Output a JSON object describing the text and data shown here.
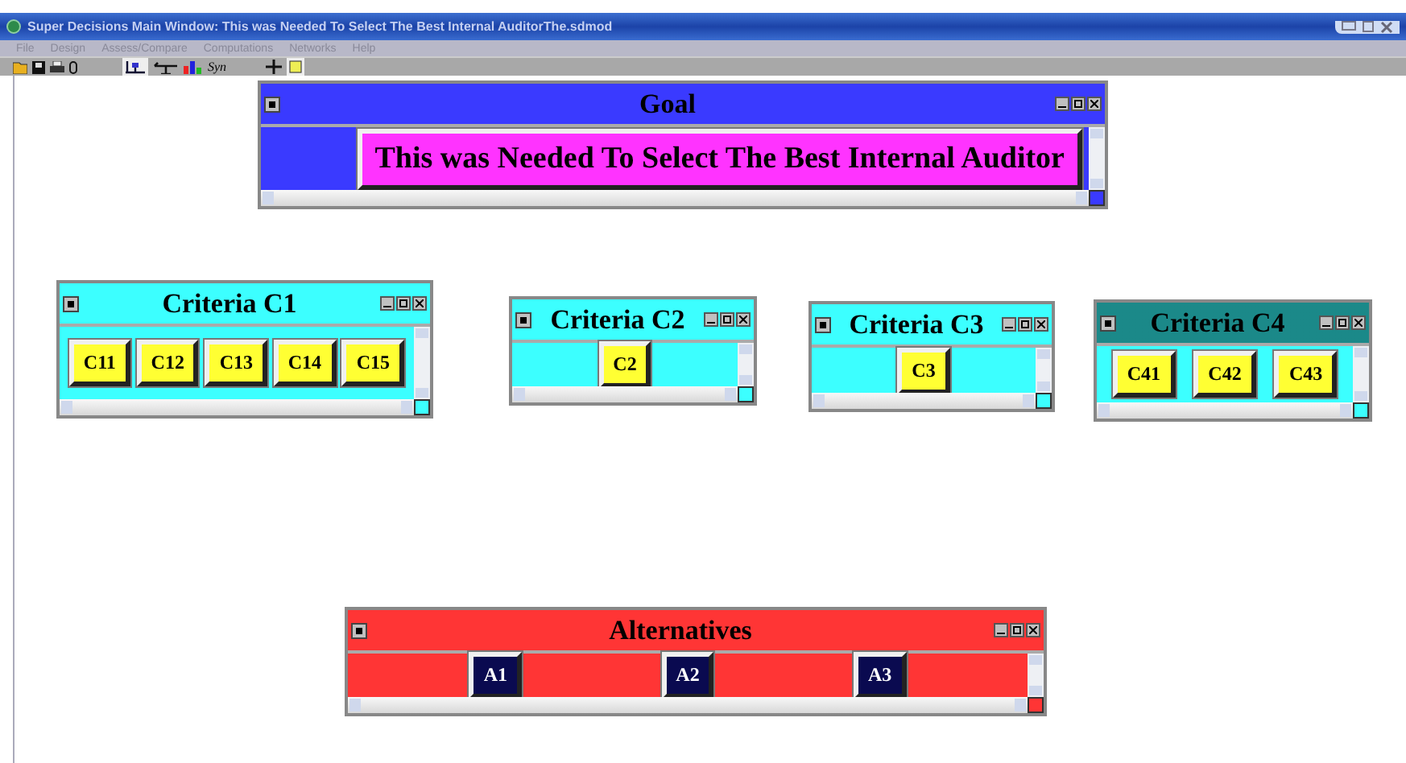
{
  "window": {
    "title": "Super Decisions Main Window: This was Needed To Select The Best Internal AuditorThe.sdmod"
  },
  "menu": [
    "File",
    "Design",
    "Assess/Compare",
    "Computations",
    "Networks",
    "Help"
  ],
  "toolbar": {
    "syn_label": "Syn"
  },
  "clusters": [
    {
      "title": "Goal",
      "kind": "goal",
      "color": "#3a3aff",
      "selected": false,
      "nodes": [
        {
          "label": "This was Needed To Select The Best Internal Auditor"
        }
      ]
    },
    {
      "title": "Criteria C1",
      "kind": "criterion",
      "color": "#3cffff",
      "selected": false,
      "nodes": [
        {
          "label": "C11"
        },
        {
          "label": "C12"
        },
        {
          "label": "C13"
        },
        {
          "label": "C14"
        },
        {
          "label": "C15"
        }
      ]
    },
    {
      "title": "Criteria C2",
      "kind": "criterion",
      "color": "#3cffff",
      "selected": false,
      "nodes": [
        {
          "label": "C2"
        }
      ]
    },
    {
      "title": "Criteria C3",
      "kind": "criterion",
      "color": "#3cffff",
      "selected": false,
      "nodes": [
        {
          "label": "C3"
        }
      ]
    },
    {
      "title": "Criteria C4",
      "kind": "criterion",
      "color": "#3cffff",
      "selected": true,
      "nodes": [
        {
          "label": "C41"
        },
        {
          "label": "C42"
        },
        {
          "label": "C43"
        }
      ]
    },
    {
      "title": "Alternatives",
      "kind": "alternative",
      "color": "#ff3535",
      "selected": false,
      "nodes": [
        {
          "label": "A1"
        },
        {
          "label": "A2"
        },
        {
          "label": "A3"
        }
      ]
    }
  ]
}
